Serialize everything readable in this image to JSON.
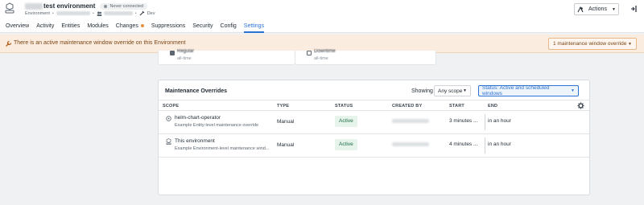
{
  "header": {
    "title": "test environment",
    "connection_badge": "Never connected",
    "breadcrumb_first": "Environment",
    "breadcrumb_last": "Dev",
    "actions_label": "Actions"
  },
  "tabs": [
    {
      "label": "Overview"
    },
    {
      "label": "Activity"
    },
    {
      "label": "Entities"
    },
    {
      "label": "Modules"
    },
    {
      "label": "Changes"
    },
    {
      "label": "Suppressions"
    },
    {
      "label": "Security"
    },
    {
      "label": "Config"
    },
    {
      "label": "Settings"
    }
  ],
  "active_tab": "Settings",
  "banner": {
    "text": "There is an active maintenance window override on this Environment",
    "button_label": "1 maintenance window override"
  },
  "upper_cards": [
    {
      "label": "Regular",
      "sub": "all-time"
    },
    {
      "label": "Downtime",
      "sub": "all-time"
    }
  ],
  "overrides": {
    "title": "Maintenance Overrides",
    "showing_label": "Showing",
    "scope_filter": "Any scope",
    "status_filter": "Status: Active and scheduled windows",
    "columns": [
      "SCOPE",
      "TYPE",
      "STATUS",
      "CREATED BY",
      "START",
      "END"
    ],
    "rows": [
      {
        "name": "helm-chart-operator",
        "description": "Example Entity-level maintenance override",
        "type": "Manual",
        "status": "Active",
        "start": "3 minutes ...",
        "end": "in an hour",
        "icon": "entity-icon"
      },
      {
        "name": "This environment",
        "description": "Example Environment-level maintenance wind...",
        "type": "Manual",
        "status": "Active",
        "start": "4 minutes ...",
        "end": "in an hour",
        "icon": "environment-icon"
      }
    ]
  },
  "colors": {
    "accent": "#2d72d2",
    "warning_bg": "#fbece0",
    "active_bg": "#e6f4ec",
    "active_text": "#1c6e42"
  }
}
